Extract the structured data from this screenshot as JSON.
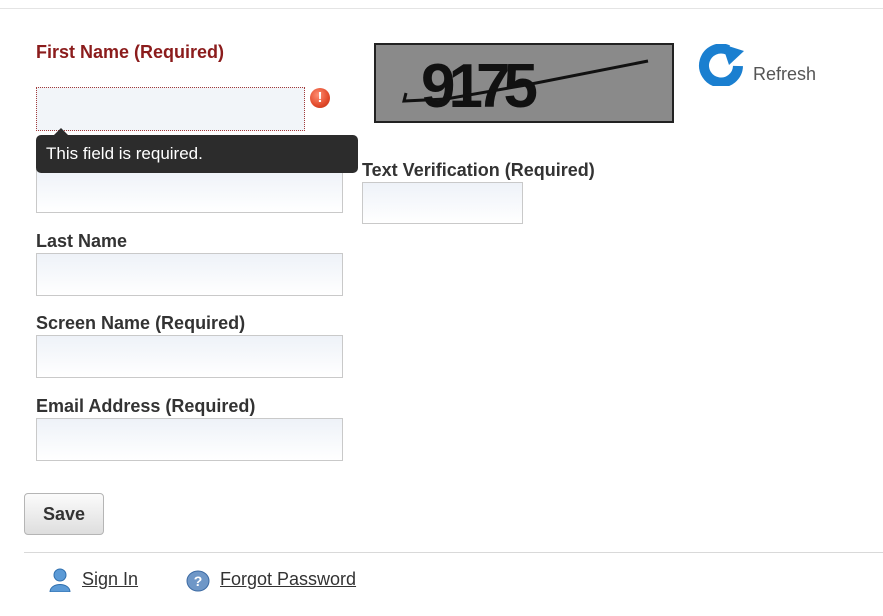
{
  "form": {
    "first_name": {
      "label": "First Name (Required)",
      "value": ""
    },
    "tooltip": "This field is required.",
    "middle_name": {
      "value": ""
    },
    "last_name": {
      "label": "Last Name",
      "value": ""
    },
    "screen_name": {
      "label": "Screen Name (Required)",
      "value": ""
    },
    "email": {
      "label": "Email Address (Required)",
      "value": ""
    },
    "save_label": "Save"
  },
  "captcha": {
    "image_text": "9175",
    "refresh_label": "Refresh",
    "refresh_icon": "refresh-icon",
    "verification": {
      "label": "Text Verification (Required)",
      "value": ""
    }
  },
  "footer": {
    "sign_in": {
      "label": "Sign In",
      "icon": "user-icon"
    },
    "forgot_password": {
      "label": "Forgot Password",
      "icon": "help-icon"
    }
  },
  "colors": {
    "error_label": "#8b1c1c",
    "tooltip_bg": "#2c2c2c",
    "refresh_blue": "#1a7fd0"
  }
}
